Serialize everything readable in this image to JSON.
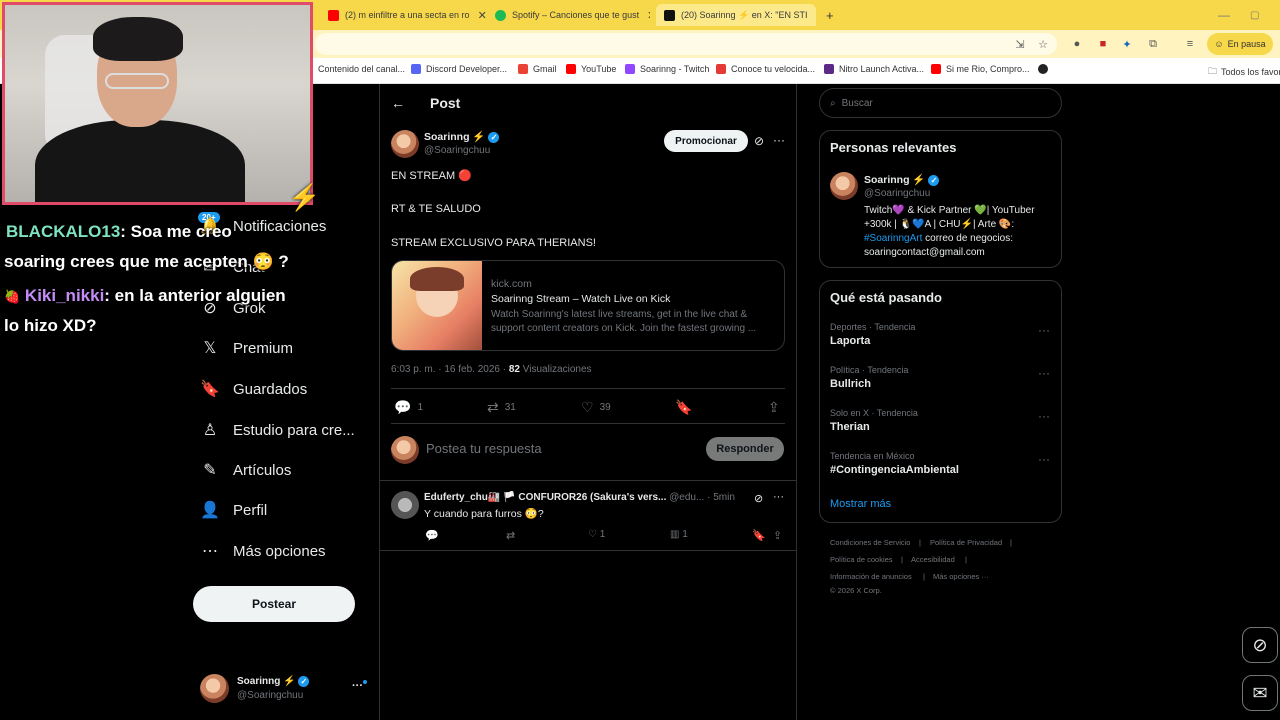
{
  "browser": {
    "tabs": [
      {
        "label": "(2) m einfiltre a una secta en ro",
        "color": "#ff0000"
      },
      {
        "label": "Spotify – Canciones que te gust",
        "color": "#1db954"
      },
      {
        "label": "(20) Soarinng ⚡ en X: \"EN STI",
        "color": "#111111"
      }
    ],
    "new_tab": "+",
    "pause_label": "En pausa",
    "bookmarks": [
      {
        "label": "Contenido del canal...",
        "color": "#ff0000"
      },
      {
        "label": "Discord Developer...",
        "color": "#5865f2"
      },
      {
        "label": "Gmail",
        "color": "#ea4335"
      },
      {
        "label": "YouTube",
        "color": "#ff0000"
      },
      {
        "label": "Soarinng - Twitch",
        "color": "#9146ff"
      },
      {
        "label": "Conoce tu velocida...",
        "color": "#e53935"
      },
      {
        "label": "Nitro Launch Activa...",
        "color": "#5b2a86"
      },
      {
        "label": "Si me Rio, Compro...",
        "color": "#ff0000"
      },
      {
        "label": "",
        "color": "#222222"
      }
    ],
    "all_bookmarks": "Todos los favor"
  },
  "chat": {
    "line1_user": "BLACKALO13",
    "line1_text": ": Soa me creo",
    "line2_text": "soaring crees que me acepten 😳 ?",
    "line3_user": "Kiki_nikki",
    "line3_text": ": en la anterior alguien",
    "line4_text": "lo hizo XD?"
  },
  "nav": {
    "badge": "20+",
    "items": [
      {
        "label": "Notificaciones",
        "icon": "🔔"
      },
      {
        "label": "Chat",
        "icon": "✉"
      },
      {
        "label": "Grok",
        "icon": "⊘"
      },
      {
        "label": "Premium",
        "icon": "𝕏"
      },
      {
        "label": "Guardados",
        "icon": "🔖"
      },
      {
        "label": "Estudio para cre...",
        "icon": "♙"
      },
      {
        "label": "Artículos",
        "icon": "✎"
      },
      {
        "label": "Perfil",
        "icon": "👤"
      },
      {
        "label": "Más opciones",
        "icon": "⋯"
      }
    ],
    "post_label": "Postear",
    "account_name": "Soarinng ⚡",
    "account_handle": "@Soaringchuu",
    "more": "···"
  },
  "post": {
    "header": "Post",
    "author": "Soarinng ⚡",
    "handle": "@Soaringchuu",
    "promote_label": "Promocionar",
    "line1": "EN STREAM 🔴",
    "line2": "RT & TE SALUDO",
    "line3": "STREAM EXCLUSIVO PARA THERIANS!",
    "card_domain": "kick.com",
    "card_title": "Soarinng Stream – Watch Live on Kick",
    "card_desc": "Watch Soarinng's latest live streams, get in the live chat & support content creators on Kick. Join the fastest growing ...",
    "meta_time": "6:03 p. m. · 16 feb. 2026 ·",
    "views_count": "82",
    "views_label": "Visualizaciones",
    "replies": "1",
    "reposts": "31",
    "likes": "39",
    "reply_placeholder": "Postea tu respuesta",
    "reply_button": "Responder"
  },
  "reply": {
    "author": "Eduferty_chu🏭 🏳️ CONFUROR26 (Sakura's vers...",
    "handle": "@edu...",
    "time": "· 5min",
    "text": "Y cuando para furros 😳?",
    "likes": "1",
    "views": "1"
  },
  "sidebar": {
    "search_placeholder": "Buscar",
    "relevant_title": "Personas relevantes",
    "person_name": "Soarinng ⚡",
    "person_handle": "@Soaringchuu",
    "bio_line1": "Twitch💜 & Kick Partner 💚| YouTuber",
    "bio_line2": "+300k | 🐧💙A | CHU⚡| Arte 🎨:",
    "bio_hashtag": "#SoarinngArt",
    "bio_line3_rest": " correo de negocios:",
    "bio_line4": "soaringcontact@gmail.com",
    "trends_title": "Qué está pasando",
    "trends": [
      {
        "category": "Deportes · Tendencia",
        "name": "Laporta"
      },
      {
        "category": "Política · Tendencia",
        "name": "Bullrich"
      },
      {
        "category": "Solo en X · Tendencia",
        "name": "Therian"
      },
      {
        "category": "Tendencia en México",
        "name": "#ContingenciaAmbiental"
      }
    ],
    "show_more": "Mostrar más",
    "footer": {
      "terms": "Condiciones de Servicio",
      "privacy": "Política de Privacidad",
      "cookies": "Política de cookies",
      "accessibility": "Accesibilidad",
      "ads": "Información de anuncios",
      "more": "Más opciones ···",
      "copyright": "© 2026 X Corp."
    }
  },
  "colors": {
    "accent": "#1d9bf0",
    "background": "#000000",
    "webcam_border": "#e04b6a",
    "tabbar": "#f7d84a"
  }
}
